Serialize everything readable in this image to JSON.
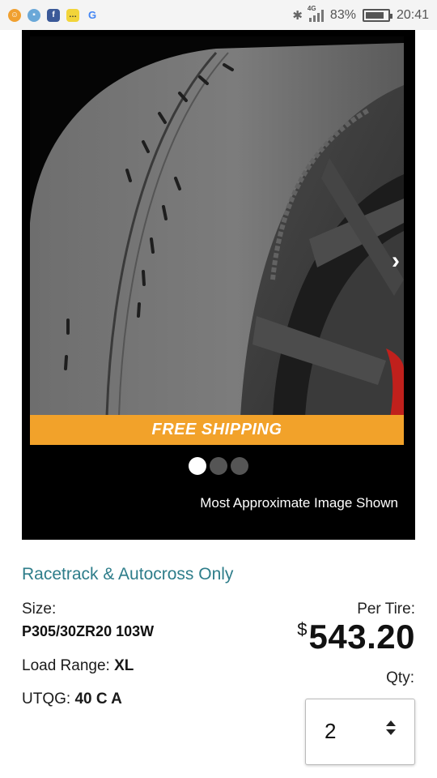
{
  "status_bar": {
    "notification_icons": [
      "orange-app-icon",
      "blue-app-icon",
      "facebook-icon",
      "kakaotalk-icon",
      "google-icon"
    ],
    "network": "4G",
    "battery": "83%",
    "battery_level": 0.83,
    "time": "20:41"
  },
  "gallery": {
    "banner": "FREE SHIPPING",
    "image_note": "Most Approximate Image Shown",
    "slide_count": 3,
    "active_slide": 1
  },
  "product": {
    "tagline": "Racetrack & Autocross Only",
    "size_label": "Size:",
    "size_value": "P305/30ZR20 103W",
    "load_label": "Load Range:",
    "load_value": "XL",
    "utqg_label": "UTQG:",
    "utqg_value": "40 C A",
    "per_tire_label": "Per Tire:",
    "currency": "$",
    "price": "543.20",
    "qty_label": "Qty:",
    "qty_value": "2"
  },
  "colors": {
    "banner": "#f2a22a",
    "tagline": "#2e7d8a"
  }
}
